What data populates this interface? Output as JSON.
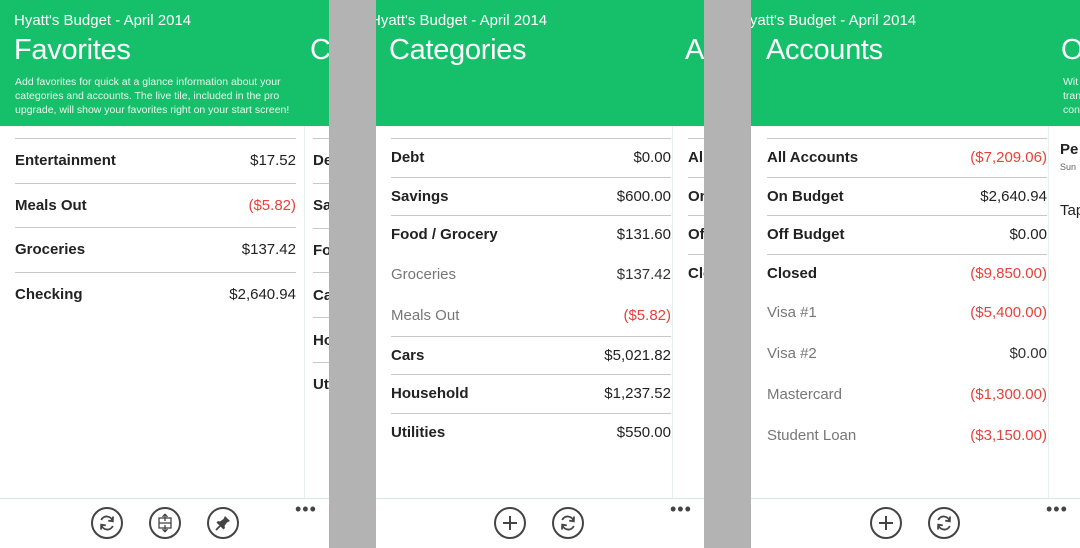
{
  "colors": {
    "accent": "#16bf6a",
    "negative": "#e4423b",
    "divider": "#b3b3b3"
  },
  "favorites": {
    "app_title": "Hyatt's Budget - April 2014",
    "title": "Favorites",
    "description": "Add favorites for quick at a glance information about your categories and accounts. The live tile, included in the pro upgrade, will show your favorites right on your start screen!",
    "peek_title": "C",
    "items": [
      {
        "name": "Entertainment",
        "value": "$17.52"
      },
      {
        "name": "Meals Out",
        "value": "($5.82)"
      },
      {
        "name": "Groceries",
        "value": "$137.42"
      },
      {
        "name": "Checking",
        "value": "$2,640.94"
      }
    ],
    "peek_items": [
      "Det",
      "Sav",
      "Foo",
      "Car",
      "Hou",
      "Uti"
    ],
    "appbar": {
      "icons": [
        "refresh-icon",
        "sort-icon",
        "pin-icon"
      ],
      "more": "•••"
    }
  },
  "categories": {
    "app_title": "Hyatt's Budget - April 2014",
    "title": "Categories",
    "peek_title": "Ac",
    "items": [
      {
        "name": "Debt",
        "value": "$0.00",
        "style": "bold"
      },
      {
        "name": "Savings",
        "value": "$600.00",
        "style": "bold"
      },
      {
        "name": "Food / Grocery",
        "value": "$131.60",
        "style": "bold"
      },
      {
        "name": "Groceries",
        "value": "$137.42",
        "style": "sub"
      },
      {
        "name": "Meals Out",
        "value": "($5.82)",
        "style": "sub"
      },
      {
        "name": "Cars",
        "value": "$5,021.82",
        "style": "bold"
      },
      {
        "name": "Household",
        "value": "$1,237.52",
        "style": "bold"
      },
      {
        "name": "Utilities",
        "value": "$550.00",
        "style": "bold"
      }
    ],
    "peek_items": [
      "All",
      "On",
      "Off",
      "Clo"
    ],
    "appbar": {
      "icons": [
        "add-icon",
        "refresh-icon"
      ],
      "more": "•••"
    }
  },
  "accounts": {
    "app_title": "Hyatt's Budget - April 2014",
    "title": "Accounts",
    "peek_title": "O",
    "peek_desc": [
      "Wit",
      "tran",
      "con"
    ],
    "items": [
      {
        "name": "All Accounts",
        "value": "($7,209.06)",
        "style": "bold"
      },
      {
        "name": "On Budget",
        "value": "$2,640.94",
        "style": "bold"
      },
      {
        "name": "Off Budget",
        "value": "$0.00",
        "style": "bold"
      },
      {
        "name": "Closed",
        "value": "($9,850.00)",
        "style": "bold"
      },
      {
        "name": "Visa #1",
        "value": "($5,400.00)",
        "style": "sub"
      },
      {
        "name": "Visa #2",
        "value": "$0.00",
        "style": "sub"
      },
      {
        "name": "Mastercard",
        "value": "($1,300.00)",
        "style": "sub"
      },
      {
        "name": "Student Loan",
        "value": "($3,150.00)",
        "style": "sub"
      }
    ],
    "peek_extra": {
      "title": "Pe",
      "sub": "Sun",
      "tap": "Tap"
    },
    "appbar": {
      "icons": [
        "add-icon",
        "refresh-icon"
      ],
      "more": "•••"
    }
  }
}
